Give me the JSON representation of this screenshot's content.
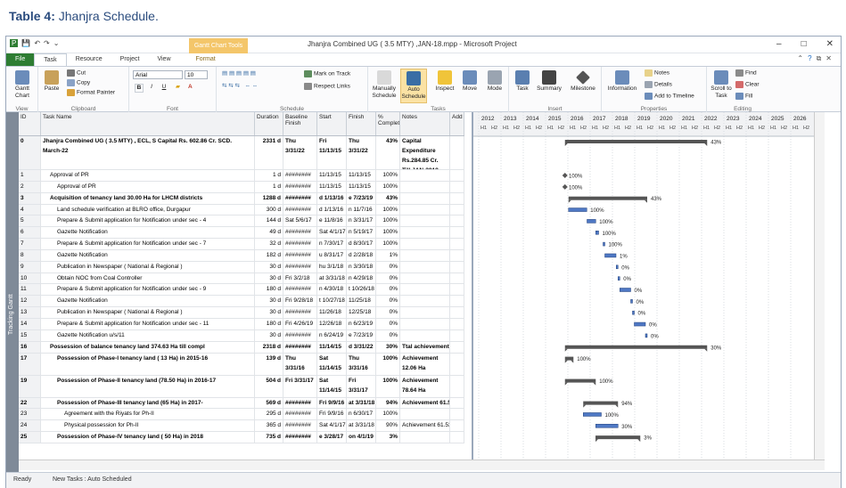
{
  "caption": {
    "label": "Table 4:",
    "text": "Jhanjra Schedule."
  },
  "window": {
    "title": "Jhanjra Combined UG ( 3.5 MTY) ,JAN-18.mpp  -  Microsoft Project",
    "context_tab": "Gantt Chart Tools",
    "qat": [
      "P",
      "💾",
      "↶",
      "↷",
      "⌄"
    ],
    "controls": [
      "–",
      "□",
      "✕"
    ]
  },
  "ribbon_tabs": [
    "File",
    "Task",
    "Resource",
    "Project",
    "View",
    "Format"
  ],
  "ribbon": {
    "view": {
      "btn": "Gantt Chart",
      "label": "View"
    },
    "clipboard": {
      "paste": "Paste",
      "cut": "Cut",
      "copy": "Copy",
      "painter": "Format Painter",
      "label": "Clipboard"
    },
    "font": {
      "face": "Arial",
      "size": "10",
      "bold": "B",
      "italic": "I",
      "underline": "U",
      "label": "Font"
    },
    "schedule": {
      "mark": "Mark on Track",
      "respect": "Respect Links",
      "label": "Schedule"
    },
    "tasks": {
      "manual": "Manually Schedule",
      "auto": "Auto Schedule",
      "inspect": "Inspect",
      "move": "Move",
      "mode": "Mode",
      "label": "Tasks"
    },
    "insert": {
      "task": "Task",
      "summary": "Summary",
      "milestone": "Milestone",
      "label": "Insert"
    },
    "properties": {
      "info": "Information",
      "notes": "Notes",
      "details": "Details",
      "timeline": "Add to Timeline",
      "label": "Properties"
    },
    "editing": {
      "scroll": "Scroll to Task",
      "find": "Find",
      "clear": "Clear",
      "fill": "Fill",
      "label": "Editing"
    }
  },
  "side_label": "Tracking Gantt",
  "columns": {
    "id": "ID",
    "name": "Task Name",
    "dur": "Duration",
    "base": "Baseline Finish",
    "start": "Start",
    "finish": "Finish",
    "pct": "% Complete",
    "notes": "Notes",
    "add": "Add"
  },
  "rows": [
    {
      "id": "0",
      "name": "Jhanjra Combined UG ( 3.5 MTY) , ECL, S Capital Rs. 602.86 Cr.  SCD. March-22",
      "dur": "2331 d",
      "base": "Thu 3/31/22",
      "start": "Fri 11/13/15",
      "finish": "Thu 3/31/22",
      "pct": "43%",
      "notes": "Capital Expenditure Rs.284.85 Cr. Till JAN-2018.",
      "bold": true,
      "h": "tall"
    },
    {
      "id": "1",
      "name": "Approval of PR",
      "dur": "1 d",
      "base": "########",
      "start": "11/13/15",
      "finish": "11/13/15",
      "pct": "100%",
      "notes": "",
      "lvl": 1
    },
    {
      "id": "2",
      "name": "Approval of PR",
      "dur": "1 d",
      "base": "########",
      "start": "11/13/15",
      "finish": "11/13/15",
      "pct": "100%",
      "notes": "",
      "lvl": 2
    },
    {
      "id": "3",
      "name": "Acquisition of tenancy  land 30.00 Ha for LHCM districts",
      "dur": "1288 d",
      "base": "########",
      "start": "d 1/13/16",
      "finish": "e 7/23/19",
      "pct": "43%",
      "notes": "",
      "lvl": 1,
      "bold": true
    },
    {
      "id": "4",
      "name": "Land schedule  verification at BLRO office, Durgapur",
      "dur": "300 d",
      "base": "########",
      "start": "d 1/13/16",
      "finish": "n 11/7/16",
      "pct": "100%",
      "notes": "",
      "lvl": 2
    },
    {
      "id": "5",
      "name": "Prepare & Submit application for Notification under sec - 4",
      "dur": "144 d",
      "base": "Sat 5/6/17",
      "start": "e 11/8/16",
      "finish": "n 3/31/17",
      "pct": "100%",
      "notes": "",
      "lvl": 2
    },
    {
      "id": "6",
      "name": "Gazette Notification",
      "dur": "49 d",
      "base": "########",
      "start": "Sat 4/1/17",
      "finish": "n 5/19/17",
      "pct": "100%",
      "notes": "",
      "lvl": 2
    },
    {
      "id": "7",
      "name": "Prepare & Submit application for Notification under sec - 7",
      "dur": "32 d",
      "base": "########",
      "start": "n 7/30/17",
      "finish": "d 8/30/17",
      "pct": "100%",
      "notes": "",
      "lvl": 2
    },
    {
      "id": "8",
      "name": "Gazette Notification",
      "dur": "182 d",
      "base": "########",
      "start": "u 8/31/17",
      "finish": "d 2/28/18",
      "pct": "1%",
      "notes": "",
      "lvl": 2
    },
    {
      "id": "9",
      "name": "Publication in Newspaper ( National & Regional )",
      "dur": "30 d",
      "base": "########",
      "start": "hu 3/1/18",
      "finish": "n 3/30/18",
      "pct": "0%",
      "notes": "",
      "lvl": 2
    },
    {
      "id": "10",
      "name": "Obtain NOC from Coal Controller",
      "dur": "30 d",
      "base": "Fri 3/2/18",
      "start": "at 3/31/18",
      "finish": "n 4/29/18",
      "pct": "0%",
      "notes": "",
      "lvl": 2
    },
    {
      "id": "11",
      "name": "Prepare & Submit application for Notification under sec - 9",
      "dur": "180 d",
      "base": "########",
      "start": "n 4/30/18",
      "finish": "t 10/26/18",
      "pct": "0%",
      "notes": "",
      "lvl": 2
    },
    {
      "id": "12",
      "name": "Gazette Notification",
      "dur": "30 d",
      "base": "Fri 9/28/18",
      "start": "t 10/27/18",
      "finish": "11/25/18",
      "pct": "0%",
      "notes": "",
      "lvl": 2
    },
    {
      "id": "13",
      "name": "Publication in Newspaper ( National & Regional )",
      "dur": "30 d",
      "base": "########",
      "start": "11/26/18",
      "finish": "12/25/18",
      "pct": "0%",
      "notes": "",
      "lvl": 2
    },
    {
      "id": "14",
      "name": "Prepare & Submit application for Notification under sec - 11",
      "dur": "180 d",
      "base": "Fri 4/26/19",
      "start": "12/26/18",
      "finish": "n 6/23/19",
      "pct": "0%",
      "notes": "",
      "lvl": 2
    },
    {
      "id": "15",
      "name": "Gazette Notification u/s/11",
      "dur": "30 d",
      "base": "########",
      "start": "n 6/24/19",
      "finish": "e 7/23/19",
      "pct": "0%",
      "notes": "",
      "lvl": 2
    },
    {
      "id": "16",
      "name": "Possession  of balance  tenancy land 374.63 Ha till compl",
      "dur": "2318 d",
      "base": "########",
      "start": "11/14/15",
      "finish": "d 3/31/22",
      "pct": "30%",
      "notes": "Ttal achievement",
      "lvl": 1,
      "bold": true
    },
    {
      "id": "17",
      "name": "Possession of Phase-I  tenancy land ( 13 Ha) in 2015-16",
      "dur": "139 d",
      "base": "Thu 3/31/16",
      "start": "Sat 11/14/15",
      "finish": "Thu 3/31/16",
      "pct": "100%",
      "notes": "Achievement 12.06 Ha",
      "lvl": 2,
      "bold": true,
      "h": "mid"
    },
    {
      "id": "19",
      "name": "Possession of Phase-II  tenancy land (78.50 Ha) in 2016-17",
      "dur": "504 d",
      "base": "Fri 3/31/17",
      "start": "Sat 11/14/15",
      "finish": "Fri 3/31/17",
      "pct": "100%",
      "notes": "Achievement 78.64 Ha",
      "lvl": 2,
      "bold": true,
      "h": "mid"
    },
    {
      "id": "22",
      "name": "Possession of Phase-III  tenancy land (65 Ha) in 2017-",
      "dur": "569 d",
      "base": "########",
      "start": "Fri 9/9/16",
      "finish": "at 3/31/18",
      "pct": "94%",
      "notes": "Achievement 61.5",
      "lvl": 2,
      "bold": true
    },
    {
      "id": "23",
      "name": "Agreement with the Riyats for Ph-II",
      "dur": "295 d",
      "base": "########",
      "start": "Fri 9/9/16",
      "finish": "n 6/30/17",
      "pct": "100%",
      "notes": "",
      "lvl": 3
    },
    {
      "id": "24",
      "name": "Physical possession for Ph-II",
      "dur": "365 d",
      "base": "########",
      "start": "Sat 4/1/17",
      "finish": "at 3/31/18",
      "pct": "90%",
      "notes": "Achievement 61.53",
      "lvl": 3
    },
    {
      "id": "25",
      "name": "Possession of Phase-IV  tenancy land ( 50 Ha) in 2018",
      "dur": "735 d",
      "base": "########",
      "start": "e 3/28/17",
      "finish": "on 4/1/19",
      "pct": "3%",
      "notes": "",
      "lvl": 2,
      "bold": true
    }
  ],
  "gantt": {
    "years": [
      "2012",
      "2013",
      "2014",
      "2015",
      "2016",
      "2017",
      "2018",
      "2019",
      "2020",
      "2021",
      "2022",
      "2023",
      "2024",
      "2025",
      "2026"
    ],
    "halves": "H1",
    "halves2": "H2",
    "bar_labels": [
      "43%",
      "100%",
      "100%",
      "43%",
      "100%",
      "100%",
      "100%",
      "100%",
      "1%",
      "0%",
      "0%",
      "0%",
      "0%",
      "0%",
      "0%",
      "0%",
      "30%",
      "100%",
      "100%",
      "94%",
      "100%",
      "30%",
      "3%"
    ]
  },
  "status": {
    "ready": "Ready",
    "new_tasks": "New Tasks : Auto Scheduled"
  }
}
